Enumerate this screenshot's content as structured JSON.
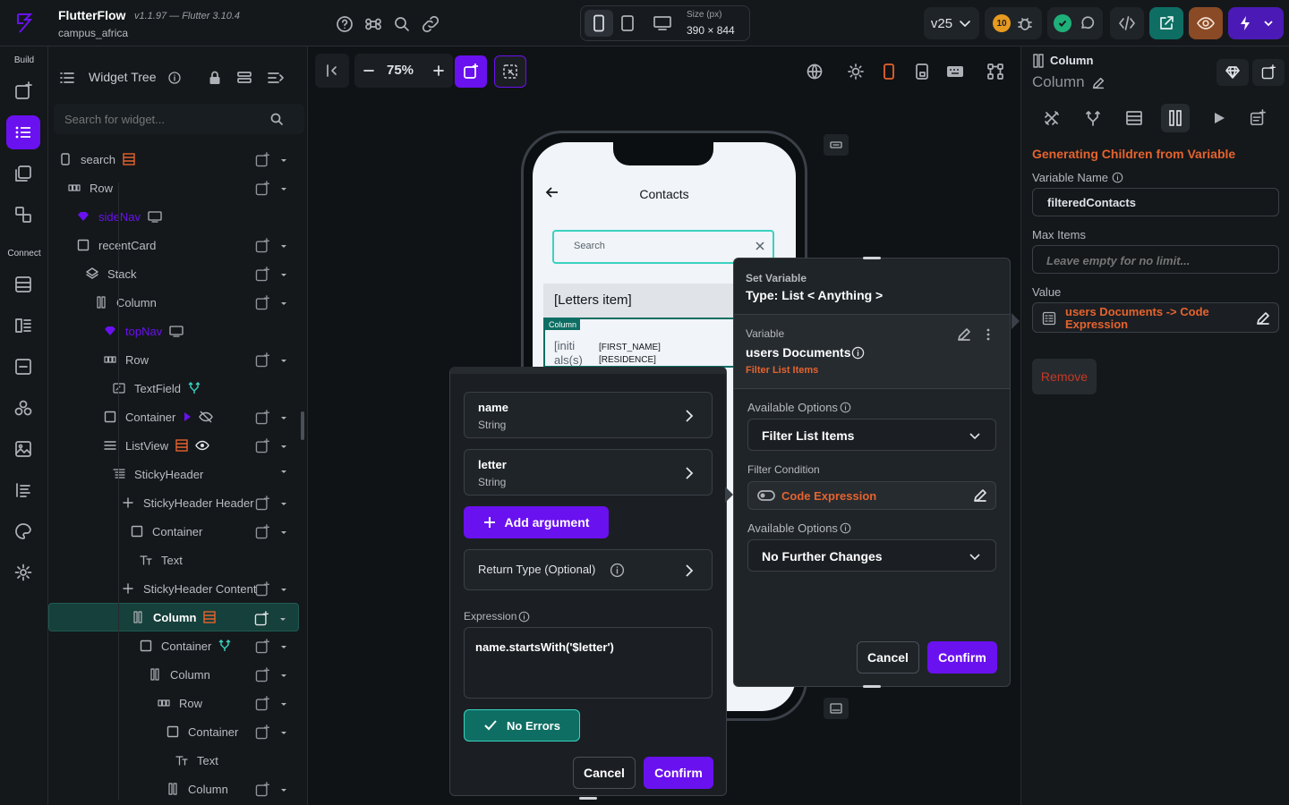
{
  "app": {
    "name": "FlutterFlow",
    "version": "v1.1.97 — Flutter 3.10.4",
    "project": "campus_africa"
  },
  "topbar": {
    "size_label": "Size (px)",
    "size_value": "390 × 844",
    "version_tag": "v25",
    "notification_count": "10"
  },
  "rail": {
    "build_label": "Build",
    "connect_label": "Connect"
  },
  "tree": {
    "title": "Widget Tree",
    "search_placeholder": "Search for widget...",
    "items": [
      {
        "label": "search"
      },
      {
        "label": "Row"
      },
      {
        "label": "sideNav"
      },
      {
        "label": "recentCard"
      },
      {
        "label": "Stack"
      },
      {
        "label": "Column"
      },
      {
        "label": "topNav"
      },
      {
        "label": "Row"
      },
      {
        "label": "TextField"
      },
      {
        "label": "Container"
      },
      {
        "label": "ListView"
      },
      {
        "label": "StickyHeader"
      },
      {
        "label": "StickyHeader Header"
      },
      {
        "label": "Container"
      },
      {
        "label": "Text"
      },
      {
        "label": "StickyHeader Content"
      },
      {
        "label": "Column"
      },
      {
        "label": "Container"
      },
      {
        "label": "Column"
      },
      {
        "label": "Row"
      },
      {
        "label": "Container"
      },
      {
        "label": "Text"
      },
      {
        "label": "Column"
      }
    ]
  },
  "canvas": {
    "zoom": "75%",
    "phone": {
      "title": "Contacts",
      "search_placeholder": "Search",
      "section": "[Letters item]",
      "column_tag": "Column",
      "initials": "[initi als(s)",
      "first_name": "[FIRST_NAME]",
      "residence": "[RESIDENCE]"
    }
  },
  "expr_modal": {
    "args": [
      {
        "name": "name",
        "type": "String"
      },
      {
        "name": "letter",
        "type": "String"
      }
    ],
    "add_argument": "Add argument",
    "return_type": "Return Type (Optional)",
    "expression_label": "Expression",
    "expression": "name.startsWith('$letter')",
    "status": "No Errors",
    "cancel": "Cancel",
    "confirm": "Confirm"
  },
  "setvar_modal": {
    "title": "Set Variable",
    "type_label": "Type: List < Anything >",
    "variable_label": "Variable",
    "variable_name": "users Documents",
    "filter_tag": "Filter List Items",
    "available_options_label": "Available Options",
    "option1": "Filter List Items",
    "filter_condition_label": "Filter Condition",
    "code_expression": "Code Expression",
    "available_options_label2": "Available Options",
    "option2": "No Further Changes",
    "cancel": "Cancel",
    "confirm": "Confirm"
  },
  "right_panel": {
    "widget_type": "Column",
    "widget_name": "Column",
    "section_title": "Generating Children from Variable",
    "variable_name_label": "Variable Name",
    "variable_name_value": "filteredContacts",
    "max_items_label": "Max Items",
    "max_items_placeholder": "Leave empty for no limit...",
    "value_label": "Value",
    "value_text": "users Documents -> Code Expression",
    "remove": "Remove"
  },
  "colors": {
    "accent": "#6a11f0",
    "orange": "#e5632e",
    "teal": "#0e6e63",
    "selected_row": "#16403b"
  }
}
